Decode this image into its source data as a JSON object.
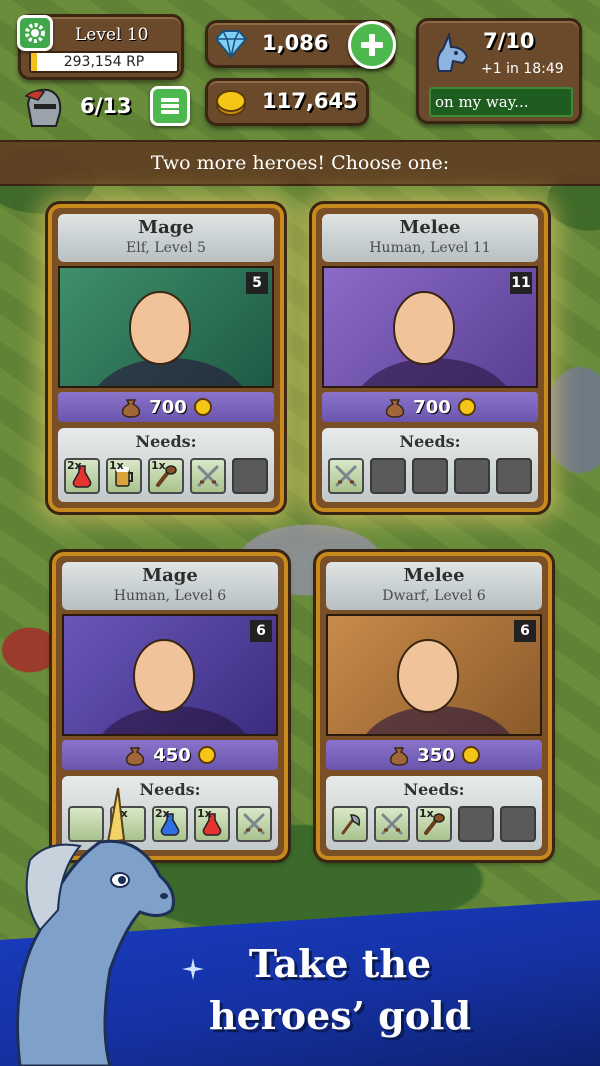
{
  "hud": {
    "level_label": "Level 10",
    "rp_value": "293,154 RP",
    "rp_progress": 0.04,
    "gems": "1,086",
    "gold": "117,645",
    "heroes_count": "6/13",
    "unicorn_count": "7/10",
    "unicorn_timer": "+1 in 18:49",
    "unicorn_status": "on my way..."
  },
  "banner": "Two more heroes! Choose one:",
  "cards": [
    {
      "class": "Mage",
      "race": "Elf, Level 5",
      "level": "5",
      "price": "700",
      "needs_label": "Needs:",
      "needs": [
        {
          "qty": "2x",
          "icon": "red-potion-icon"
        },
        {
          "qty": "1x",
          "icon": "ale-mug-icon"
        },
        {
          "qty": "1x",
          "icon": "club-icon"
        },
        {
          "qty": "",
          "icon": "crossed-swords-icon"
        },
        {
          "qty": "",
          "icon": "empty-slot"
        }
      ]
    },
    {
      "class": "Melee",
      "race": "Human, Level 11",
      "level": "11",
      "price": "700",
      "needs_label": "Needs:",
      "needs": [
        {
          "qty": "",
          "icon": "crossed-swords-icon"
        },
        {
          "qty": "",
          "icon": "empty-slot"
        },
        {
          "qty": "",
          "icon": "empty-slot"
        },
        {
          "qty": "",
          "icon": "empty-slot"
        },
        {
          "qty": "",
          "icon": "empty-slot"
        }
      ]
    },
    {
      "class": "Mage",
      "race": "Human, Level 6",
      "level": "6",
      "price": "450",
      "needs_label": "Needs:",
      "needs": [
        {
          "qty": "",
          "icon": "hidden-slot"
        },
        {
          "qty": "1x",
          "icon": "hidden-slot"
        },
        {
          "qty": "2x",
          "icon": "blue-potion-icon"
        },
        {
          "qty": "1x",
          "icon": "red-potion-icon"
        },
        {
          "qty": "",
          "icon": "crossed-swords-icon"
        }
      ]
    },
    {
      "class": "Melee",
      "race": "Dwarf, Level 6",
      "level": "6",
      "price": "350",
      "needs_label": "Needs:",
      "needs": [
        {
          "qty": "",
          "icon": "axe-icon"
        },
        {
          "qty": "",
          "icon": "crossed-swords-icon"
        },
        {
          "qty": "1x",
          "icon": "club-icon"
        },
        {
          "qty": "",
          "icon": "empty-slot"
        },
        {
          "qty": "",
          "icon": "empty-slot"
        }
      ]
    }
  ],
  "promo": {
    "line1": "Take the",
    "line2": "heroes’ gold"
  },
  "colors": {
    "accent_green": "#4cb84e",
    "price_purple": "#7a63bb",
    "card_gold": "#c98a1d",
    "promo_blue": "#1a3dc2"
  }
}
